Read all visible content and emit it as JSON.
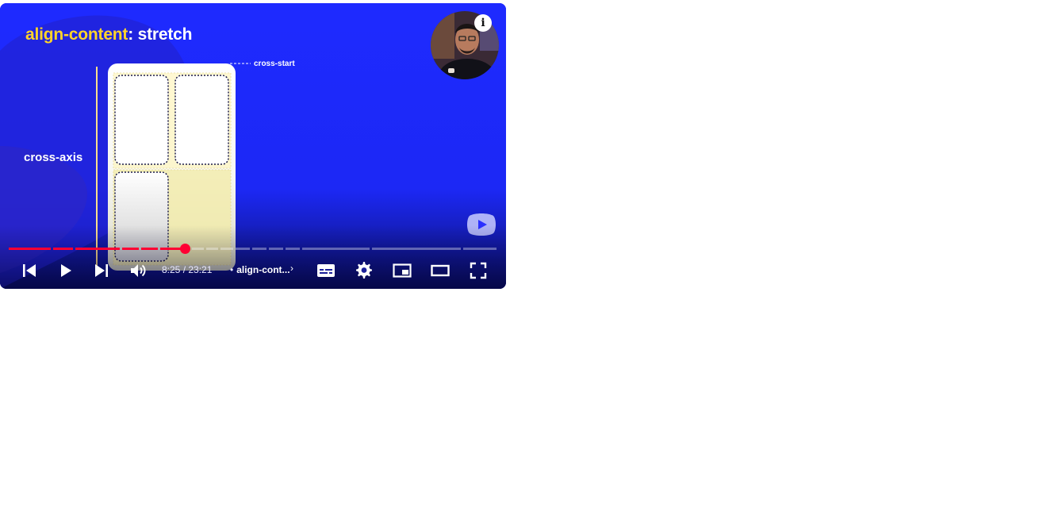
{
  "video": {
    "title_keyword": "align-content",
    "title_value": ": stretch",
    "axis_label": "cross-axis",
    "cross_start_label": "cross-start"
  },
  "overlay": {
    "info_label": "i"
  },
  "player": {
    "time_current": "8:25",
    "time_separator": " / ",
    "time_total": "23:21",
    "chapter_separator": "•",
    "chapter_title": "align-cont...",
    "chapter_chevron": "›",
    "progress_fraction": 0.361,
    "accent_color": "#ff0033",
    "controls": [
      "previous-icon",
      "play-icon",
      "next-icon",
      "volume-icon",
      "subtitles-icon",
      "settings-icon",
      "miniplayer-icon",
      "theater-mode-icon",
      "fullscreen-icon"
    ]
  }
}
